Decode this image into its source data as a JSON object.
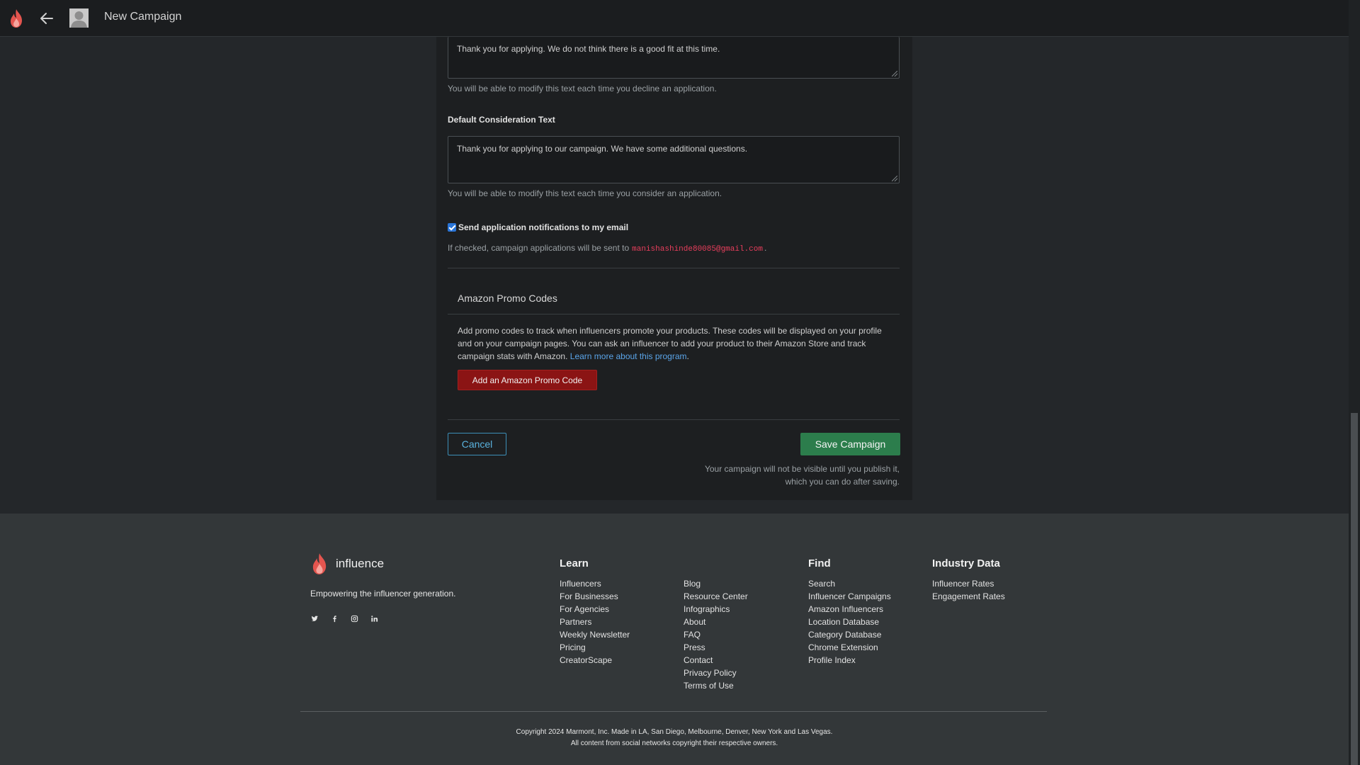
{
  "header": {
    "title": "New Campaign"
  },
  "decline": {
    "text": "Thank you for applying. We do not think there is a good fit at this time.",
    "help": "You will be able to modify this text each time you decline an application."
  },
  "consideration": {
    "label": "Default Consideration Text",
    "text": "Thank you for applying to our campaign. We have some additional questions.",
    "help": "You will be able to modify this text each time you consider an application."
  },
  "notifications": {
    "checked": true,
    "label": "Send application notifications to my email",
    "prefix": "If checked, campaign applications will be sent to",
    "email": "manishashinde80085@gmail.com",
    "suffix": "."
  },
  "promo": {
    "title": "Amazon Promo Codes",
    "text": "Add promo codes to track when influencers promote your products. These codes will be displayed on your profile and on your campaign pages. You can ask an influencer to add your product to their Amazon Store and track campaign stats with Amazon.",
    "link": "Learn more about this program",
    "link_suffix": ".",
    "button": "Add an Amazon Promo Code"
  },
  "actions": {
    "cancel": "Cancel",
    "save": "Save Campaign",
    "note_line1": "Your campaign will not be visible until you publish it,",
    "note_line2": "which you can do after saving."
  },
  "footer": {
    "brand": "influence",
    "tagline": "Empowering the influencer generation.",
    "socials": [
      "twitter-icon",
      "facebook-icon",
      "instagram-icon",
      "linkedin-icon"
    ],
    "learn_title": "Learn",
    "learn_col1": [
      "Influencers",
      "For Businesses",
      "For Agencies",
      "Partners",
      "Weekly Newsletter",
      "Pricing",
      "CreatorScape"
    ],
    "learn_col2": [
      "Blog",
      "Resource Center",
      "Infographics",
      "About",
      "FAQ",
      "Press",
      "Contact",
      "Privacy Policy",
      "Terms of Use"
    ],
    "find_title": "Find",
    "find_links": [
      "Search",
      "Influencer Campaigns",
      "Amazon Influencers",
      "Location Database",
      "Category Database",
      "Chrome Extension",
      "Profile Index"
    ],
    "industry_title": "Industry Data",
    "industry_links": [
      "Influencer Rates",
      "Engagement Rates"
    ],
    "copyright1": "Copyright 2024 Marmont, Inc. Made in LA, San Diego, Melbourne, Denver, New York and Las Vegas.",
    "copyright2": "All content from social networks copyright their respective owners."
  },
  "colors": {
    "accent_red": "#8b1414",
    "save_green": "#2c7d4c",
    "link_blue": "#5aa4e8",
    "email_pink": "#e83e5c"
  }
}
